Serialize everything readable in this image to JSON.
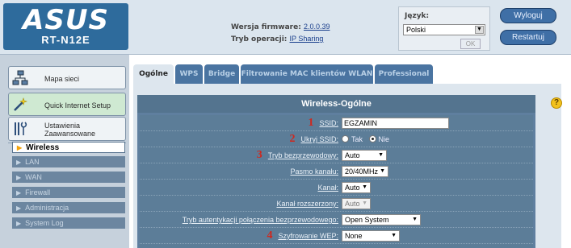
{
  "header": {
    "logo_brand": "ASUS",
    "logo_model": "RT-N12E",
    "firmware_label": "Wersja firmware:",
    "firmware_value": "2.0.0.39",
    "mode_label": "Tryb operacji:",
    "mode_value": "IP Sharing",
    "language_label": "Język:",
    "language_value": "Polski",
    "ok_label": "OK",
    "logout_label": "Wyloguj",
    "restart_label": "Restartuj"
  },
  "sidebar": {
    "main_items": [
      {
        "label": "Mapa sieci",
        "icon": "network-map-icon"
      },
      {
        "label": "Quick Internet Setup",
        "icon": "magic-wand-icon"
      },
      {
        "label": "Ustawienia Zaawansowane",
        "icon": "tools-icon"
      }
    ],
    "sub_items": [
      {
        "label": "Wireless",
        "active": true
      },
      {
        "label": "LAN",
        "active": false
      },
      {
        "label": "WAN",
        "active": false
      },
      {
        "label": "Firewall",
        "active": false
      },
      {
        "label": "Administracja",
        "active": false
      },
      {
        "label": "System Log",
        "active": false
      }
    ]
  },
  "tabs": [
    {
      "label": "Ogólne",
      "active": true
    },
    {
      "label": "WPS",
      "active": false
    },
    {
      "label": "Bridge",
      "active": false
    },
    {
      "label": "Filtrowanie MAC klientów WLAN",
      "active": false
    },
    {
      "label": "Professional",
      "active": false
    }
  ],
  "panel": {
    "title": "Wireless-Ogólne",
    "rows": [
      {
        "marker": "1",
        "label": "SSID:",
        "value": "EGZAMIN"
      },
      {
        "marker": "2",
        "label": "Ukryj SSID:",
        "option_yes": "Tak",
        "option_no": "Nie",
        "selected": "Nie"
      },
      {
        "marker": "3",
        "label": "Tryb bezprzewodowy:",
        "value": "Auto"
      },
      {
        "label": "Pasmo kanału:",
        "value": "20/40MHz"
      },
      {
        "label": "Kanał:",
        "value": "Auto"
      },
      {
        "label": "Kanał rozszerzony:",
        "value": "Auto"
      },
      {
        "label": "Tryb autentykacji połączenia bezprzewodowego:",
        "value": "Open System"
      },
      {
        "marker": "4",
        "label": "Szyfrowanie WEP:",
        "value": "None"
      }
    ]
  },
  "help_icon": "help-question-icon",
  "colors": {
    "accent_blue": "#4a74a1",
    "panel_blue": "#5f7f9f",
    "marker_red": "#d0271d",
    "active_arrow": "#f4a30b"
  }
}
